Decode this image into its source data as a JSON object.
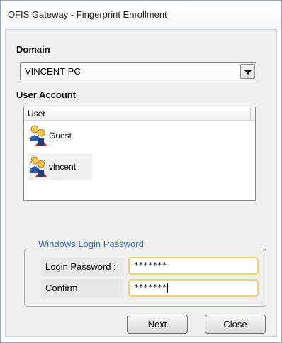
{
  "window": {
    "title": "OFIS Gateway - Fingerprint Enrollment"
  },
  "domain": {
    "label": "Domain",
    "selected": "VINCENT-PC",
    "dropdown_icon": "chevron-down-icon"
  },
  "user_account": {
    "label": "User Account",
    "column_header": "User",
    "users": [
      {
        "name": "Guest",
        "icon": "user-icon"
      },
      {
        "name": "vincent",
        "icon": "user-icon"
      }
    ]
  },
  "password_group": {
    "title": "Windows Login Password",
    "login_label": "Login Password :",
    "login_value": "*******",
    "confirm_label": "Confirm",
    "confirm_value": "*******"
  },
  "buttons": {
    "next": "Next",
    "close": "Close"
  },
  "colors": {
    "group_title": "#2e67b1",
    "input_border": "#e9d56a",
    "client_background": "#f0f0f0"
  }
}
